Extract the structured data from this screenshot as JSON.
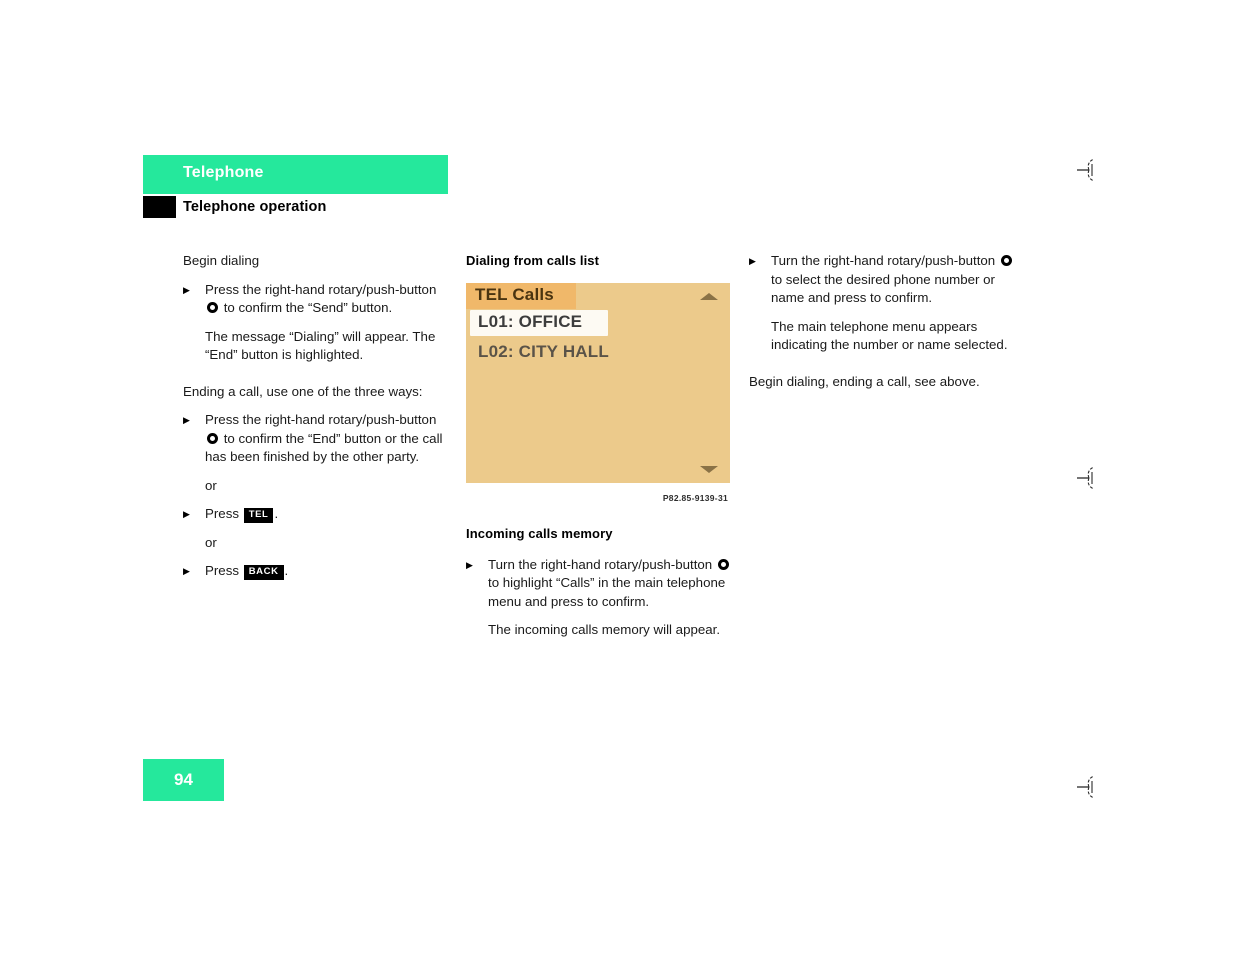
{
  "header": {
    "chapter": "Telephone",
    "section": "Telephone operation"
  },
  "left_column": {
    "heading": "Begin dialing",
    "step1_a": "Press the right-hand rotary/push-button",
    "step1_b": "to confirm the “Send” button.",
    "note1": "The message “Dialing” will appear. The “End” button is highlighted.",
    "ending_intro": "Ending a call, use one of the three ways:",
    "step2_a": "Press the right-hand rotary/push-button",
    "step2_b": "to confirm the “End” button or the call has been finished by the other party.",
    "or_1": "or",
    "step3_prefix": "Press",
    "step3_key": "TEL",
    "step3_suffix": ".",
    "or_2": "or",
    "step4_prefix": "Press",
    "step4_key": "BACK",
    "step4_suffix": "."
  },
  "middle_column": {
    "heading": "Dialing from calls list",
    "display": {
      "title": "TEL Calls",
      "rows": [
        "L01: OFFICE",
        "L02: CITY HALL"
      ],
      "scroll_up_icon": "triangle-up-icon",
      "scroll_down_icon": "triangle-down-icon"
    },
    "figure_caption": "P82.85-9139-31",
    "subheading": "Incoming calls memory",
    "step1_a": "Turn the right-hand rotary/push-button",
    "step1_b": "to highlight “Calls” in the main telephone menu and press to confirm.",
    "note1": "The incoming calls memory will appear."
  },
  "right_column": {
    "step1_a": "Turn the right-hand rotary/push-button",
    "step1_b": "to select the desired phone number or name and press to confirm.",
    "note1": "The main telephone menu appears indicating the number or name selected.",
    "closing": "Begin dialing, ending a call, see above."
  },
  "footer": {
    "page_number": "94"
  },
  "colors": {
    "accent_green": "#25e89c",
    "display_background": "#ecca8b",
    "display_header_band": "#f0b86a",
    "display_selected_row": "#fdfaf3",
    "marker_black": "#000000"
  },
  "cut_marks": {
    "icon": "scissors-cut-mark-icon",
    "count": 3
  }
}
